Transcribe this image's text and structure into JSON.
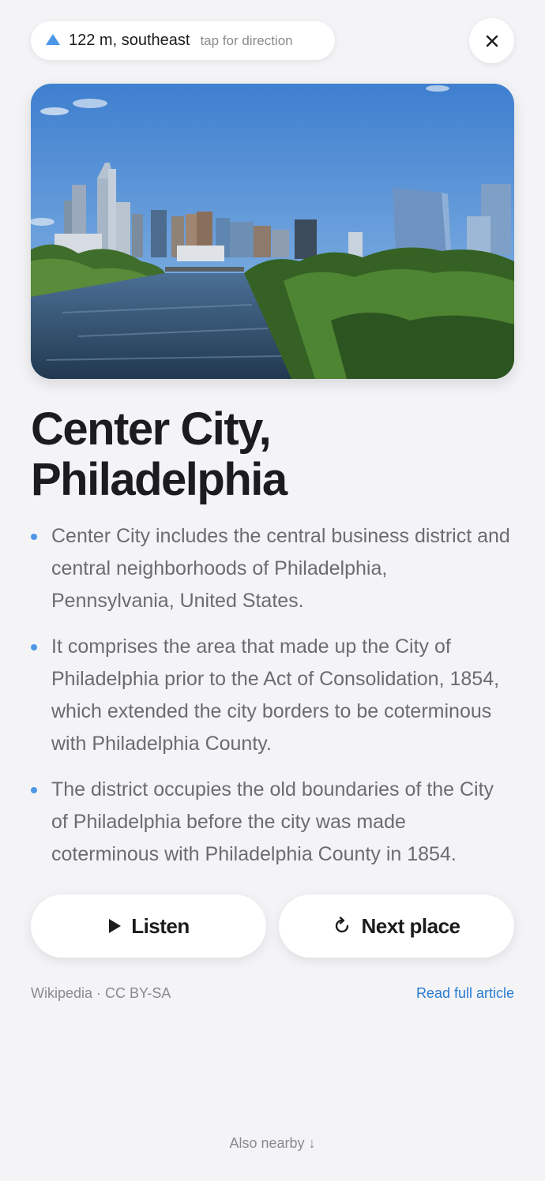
{
  "direction": {
    "distance": "122 m, southeast",
    "hint": "tap for direction",
    "icon": "direction-arrow-icon"
  },
  "close": {
    "icon": "close-icon"
  },
  "hero_image": {
    "subject": "Philadelphia skyline over river"
  },
  "article": {
    "title": "Center City, Philadelphia",
    "bullets": [
      "Center City includes the central business district and central neighborhoods of Philadelphia, Pennsylvania, United States.",
      "It comprises the area that made up the City of Philadelphia prior to the Act of Consolidation, 1854, which extended the city borders to be coterminous with Philadelphia County.",
      "The district occupies the old boundaries of the City of Philadelphia before the city was made coterminous with Philadelphia County in 1854."
    ]
  },
  "actions": {
    "listen_label": "Listen",
    "listen_icon": "play-icon",
    "next_label": "Next place",
    "next_icon": "refresh-icon"
  },
  "footer": {
    "credit": "Wikipedia · CC BY-SA",
    "read_more": "Read full article",
    "nearby": "Also nearby ↓"
  },
  "colors": {
    "accent": "#4c97e6",
    "link": "#2a7bd1",
    "background": "#f4f4f7"
  }
}
